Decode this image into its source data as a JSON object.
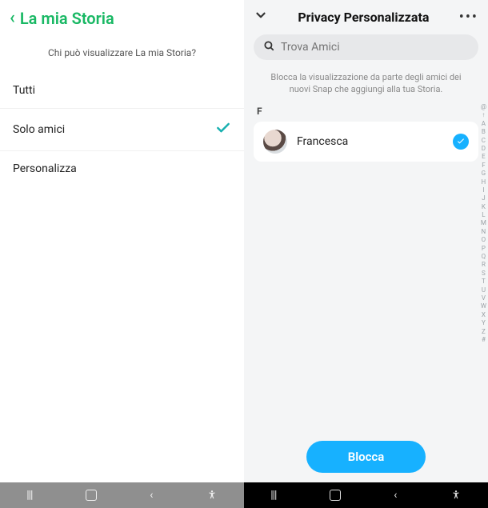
{
  "left": {
    "title": "La mia Storia",
    "subtitle": "Chi può visualizzare La mia Storia?",
    "options": [
      {
        "label": "Tutti",
        "selected": false
      },
      {
        "label": "Solo amici",
        "selected": true
      },
      {
        "label": "Personalizza",
        "selected": false
      }
    ]
  },
  "right": {
    "title": "Privacy Personalizzata",
    "search_placeholder": "Trova Amici",
    "description": "Blocca la visualizzazione da parte degli amici dei nuovi Snap che aggiungi alla tua Storia.",
    "section_letter": "F",
    "friend": {
      "name": "Francesca"
    },
    "index": [
      "@",
      "↑",
      "A",
      "B",
      "C",
      "D",
      "E",
      "F",
      "G",
      "H",
      "I",
      "J",
      "K",
      "L",
      "M",
      "N",
      "O",
      "P",
      "Q",
      "R",
      "S",
      "T",
      "U",
      "V",
      "W",
      "X",
      "Y",
      "Z",
      "#"
    ],
    "block_label": "Blocca"
  }
}
